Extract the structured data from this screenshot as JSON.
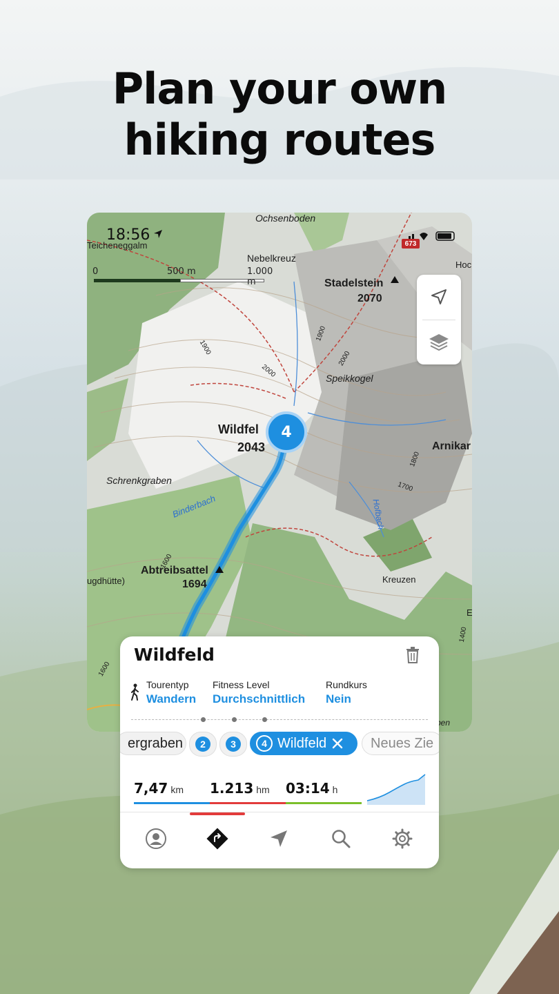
{
  "headline": {
    "line1": "Plan your own",
    "line2": "hiking routes"
  },
  "status_bar": {
    "time": "18:56",
    "speed_sign": "673"
  },
  "map": {
    "scale_labels": [
      "0",
      "500 m",
      "1.000 m"
    ],
    "labels": {
      "teicheneggalm": "Teicheneggalm",
      "ochsenboden": "Ochsenboden",
      "nebelkreuz": "Nebelkreuz",
      "stadelstein_name": "Stadelstein",
      "stadelstein_elev": "2070",
      "speikkogel": "Speikkogel",
      "wildfeld_name": "Wildfel",
      "wildfeld_elev": "2043",
      "arnikar": "Arnikar",
      "schrenkgraben": "Schrenkgraben",
      "binderbach": "Binderbach",
      "hofbach": "Hofbach",
      "abtreibsattel_name": "Abtreibsattel",
      "abtreibsattel_elev": "1694",
      "gdhutte": "ugdhütte)",
      "kreuzen": "Kreuzen",
      "contour_1900a": "1900",
      "contour_1900b": "1900",
      "contour_2000a": "2000",
      "contour_2000b": "2000",
      "contour_1800": "1800",
      "contour_1700": "1700",
      "contour_1600a": "1600",
      "contour_1600b": "1600",
      "contour_1400": "1400",
      "hoc": "Hoc",
      "ben": "ben",
      "cut_e": "E"
    },
    "waypoint_marker": "4"
  },
  "route_card": {
    "title": "Wildfeld",
    "tour_type_label": "Tourentyp",
    "tour_type_value": "Wandern",
    "fitness_label": "Fitness Level",
    "fitness_value": "Durchschnittlich",
    "round_label": "Rundkurs",
    "round_value": "Nein",
    "chips": {
      "chip1": "ergraben",
      "chip2_num": "2",
      "chip3_num": "3",
      "chip4_num": "4",
      "chip4_label": "Wildfeld",
      "chip5": "Neues Zie"
    },
    "stats": {
      "distance_value": "7,47",
      "distance_unit": "km",
      "elevation_value": "1.213",
      "elevation_unit": "hm",
      "duration_value": "03:14",
      "duration_unit": "h"
    }
  },
  "tabbar": {
    "icons": [
      "profile-icon",
      "route-planner-icon",
      "navigation-icon",
      "search-icon",
      "settings-icon"
    ]
  },
  "colors": {
    "accent_blue": "#1e8fe0",
    "distance_bar": "#1e8fe0",
    "elevation_bar": "#e23b3b",
    "duration_bar": "#7bbf2a",
    "tab_indicator": "#e23b3b"
  }
}
